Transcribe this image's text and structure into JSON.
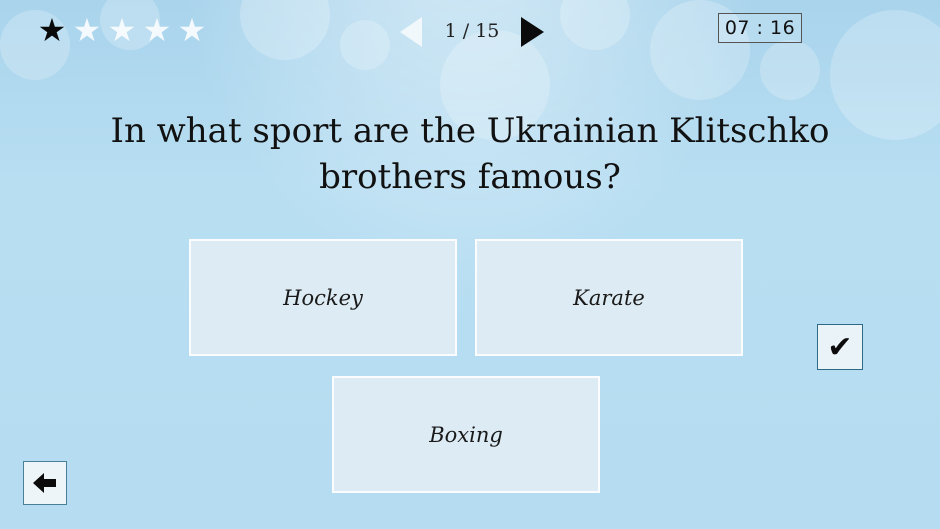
{
  "rating": {
    "stars": [
      "★",
      "★",
      "★",
      "★",
      "★"
    ],
    "filled": 1,
    "max": 5
  },
  "navigation": {
    "counter": "1 / 15",
    "prev_icon": "arrow-left-icon",
    "next_icon": "arrow-right-icon"
  },
  "timer": "07 : 16",
  "question": "In what sport are the Ukrainian Klitschko brothers famous?",
  "answers": [
    "Hockey",
    "Karate",
    "Boxing"
  ],
  "controls": {
    "confirm_glyph": "✔",
    "confirm_icon": "checkmark-icon",
    "back_glyph": "🡄",
    "back_icon": "back-arrow-icon"
  },
  "colors": {
    "background": "#b9def1",
    "answer_box": "#dcebf4",
    "text": "#111111"
  }
}
